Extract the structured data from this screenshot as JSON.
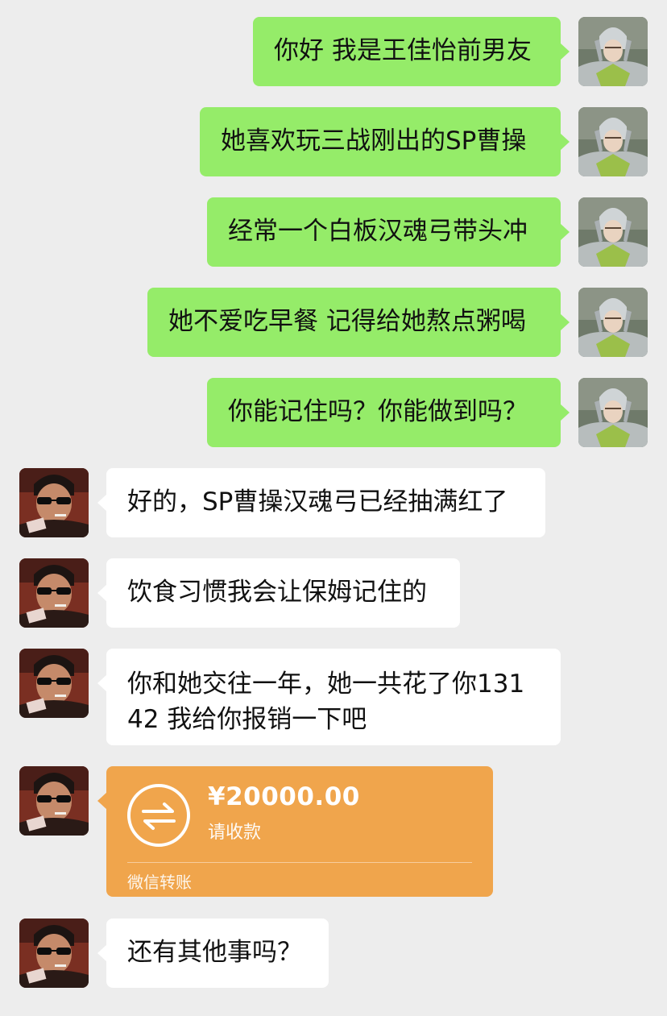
{
  "messages_sent": [
    {
      "text": "你好 我是王佳怡前男友"
    },
    {
      "text": "她喜欢玩三战刚出的SP曹操"
    },
    {
      "text": "经常一个白板汉魂弓带头冲"
    },
    {
      "text": "她不爱吃早餐 记得给她熬点粥喝"
    },
    {
      "text": "你能记住吗？你能做到吗？"
    }
  ],
  "messages_received": [
    {
      "text": "好的，SP曹操汉魂弓已经抽满红了"
    },
    {
      "text": "饮食习惯我会让保姆记住的"
    },
    {
      "text": "你和她交往一年，她一共花了你13142 我给你报销一下吧"
    },
    {
      "text": "还有其他事吗？"
    }
  ],
  "transfer": {
    "amount": "¥20000.00",
    "status": "请收款",
    "label": "微信转账",
    "icon": "transfer-arrows-icon"
  },
  "colors": {
    "background": "#ededed",
    "sent_bubble": "#95ec69",
    "received_bubble": "#ffffff",
    "transfer_card": "#f0a54c"
  }
}
